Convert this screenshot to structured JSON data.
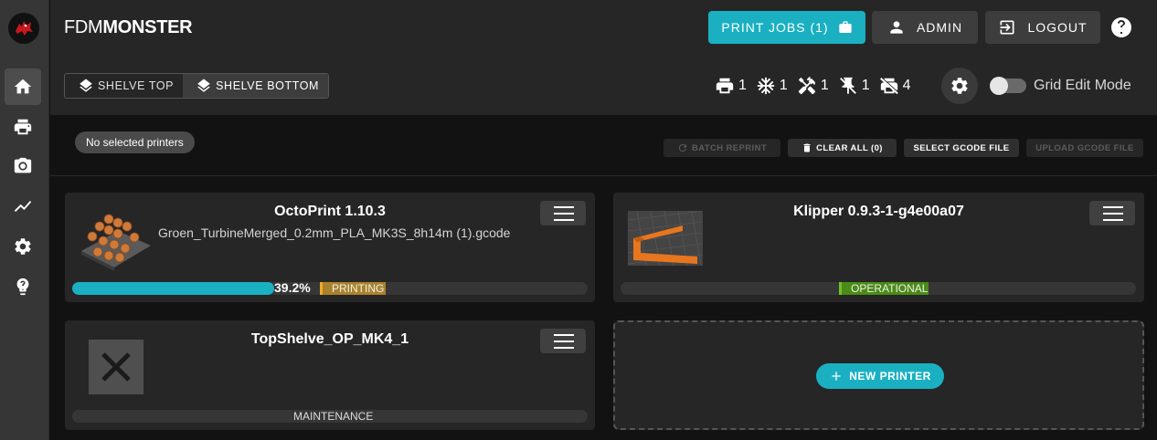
{
  "brand": {
    "part1": "FDM",
    "part2": "MONSTER"
  },
  "header": {
    "print_jobs_label": "PRINT JOBS (1)",
    "admin_label": "ADMIN",
    "logout_label": "LOGOUT"
  },
  "shelves": [
    {
      "label": "SHELVE TOP"
    },
    {
      "label": "SHELVE BOTTOM"
    }
  ],
  "stats": {
    "printing": "1",
    "cooling": "1",
    "maintenance": "1",
    "disconnected": "1",
    "disabled": "4"
  },
  "grid_edit_label": "Grid Edit Mode",
  "selection_chip": "No selected printers",
  "actions": {
    "batch_reprint": "BATCH REPRINT",
    "clear_all": "CLEAR ALL (0)",
    "select_gcode": "SELECT GCODE FILE",
    "upload_gcode": "UPLOAD GCODE FILE"
  },
  "printers": [
    {
      "name": "OctoPrint 1.10.3",
      "file": "Groen_TurbineMerged_0.2mm_PLA_MK3S_8h14m (1).gcode",
      "progress_text": "39.2%",
      "progress": 0.392,
      "status": "PRINTING"
    },
    {
      "name": "Klipper 0.9.3-1-g4e00a07",
      "status": "OPERATIONAL"
    },
    {
      "name": "TopShelve_OP_MK4_1",
      "status": "MAINTENANCE"
    }
  ],
  "new_printer_label": "NEW PRINTER",
  "colors": {
    "accent": "#1ab0c2",
    "printing": "#f0a929",
    "operational": "#6fbf2a"
  }
}
